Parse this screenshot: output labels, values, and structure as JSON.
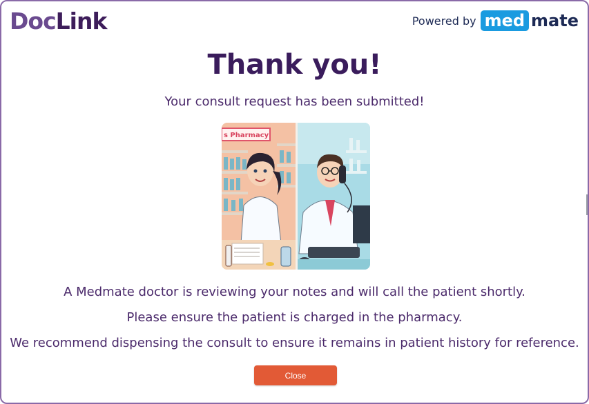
{
  "header": {
    "logo_part1": "Doc",
    "logo_part2": "Link",
    "powered_by": "Powered by",
    "medmate_part1": "med",
    "medmate_part2": "mate"
  },
  "main": {
    "title": "Thank you!",
    "subtitle": "Your consult request has been submitted!",
    "illustration_sign": "s Pharmacy",
    "messages": [
      "A Medmate doctor is reviewing your notes and will call the patient shortly.",
      "Please ensure the patient is charged in the pharmacy.",
      "We recommend dispensing the consult to ensure it remains in patient history for reference."
    ],
    "close_label": "Close"
  },
  "colors": {
    "title": "#3a1c5c",
    "text": "#4b2a6b",
    "button": "#e25a36",
    "medmate_blue": "#1a9be0"
  }
}
